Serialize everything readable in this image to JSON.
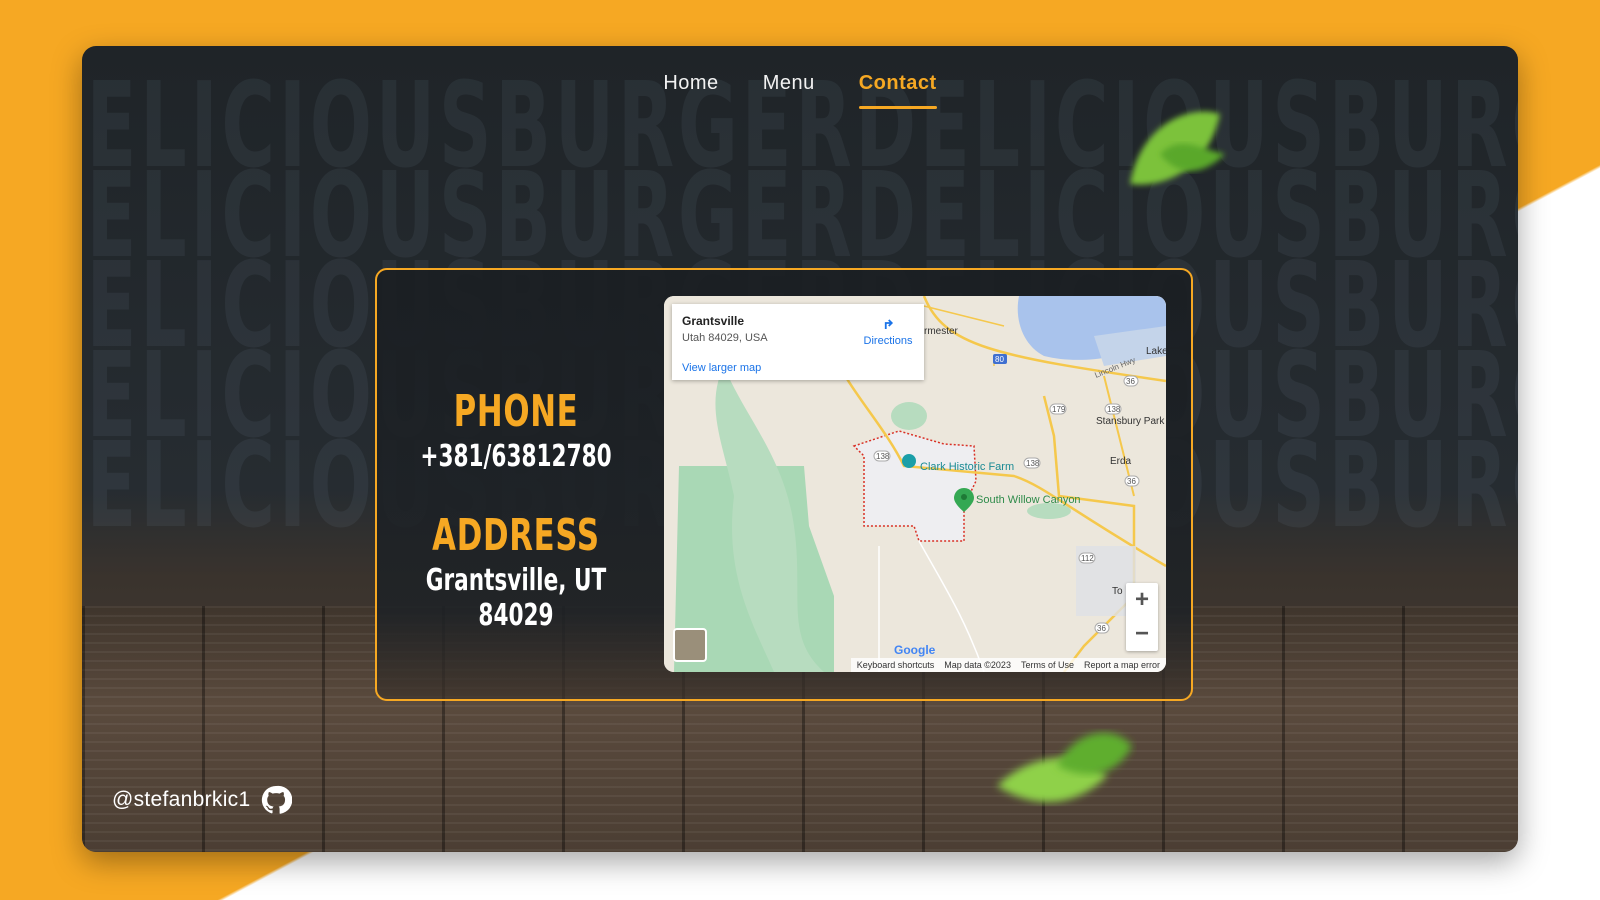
{
  "brand_color": "#f6a823",
  "background_text": [
    "DELICIOUSBURGERDELICIOUSBURGER",
    "DELICIOUSBURGERDELICIOUSBURGER",
    "DELICIOUSBURGERDELICIOUSBURGER",
    "DELICIOUSBURGERDELICIOUSBURGER",
    "DELICIOUSBURGERDELICIOUSBURGER"
  ],
  "nav": {
    "home": "Home",
    "menu": "Menu",
    "contact": "Contact",
    "active": "Contact"
  },
  "contact": {
    "phone_label": "PHONE",
    "phone_value": "+381/63812780",
    "address_label": "ADDRESS",
    "address_value": "Grantsville, UT 84029"
  },
  "map": {
    "place_title": "Grantsville",
    "place_subtitle": "Utah 84029, USA",
    "directions_label": "Directions",
    "larger_map_link": "View larger map",
    "labels": {
      "clark": "Clark Historic Farm",
      "willow": "South Willow Canyon",
      "stansbury": "Stansbury Park",
      "erda": "Erda",
      "lake": "Lake",
      "lincoln": "Lincoln Hwy",
      "rmester": "rmester",
      "to": "To",
      "google": "Google"
    },
    "road_badges": [
      "80",
      "179",
      "138",
      "138",
      "36",
      "36",
      "112",
      "36",
      "138"
    ],
    "footer": [
      "Keyboard shortcuts",
      "Map data ©2023",
      "Terms of Use",
      "Report a map error"
    ],
    "zoom_in": "+",
    "zoom_out": "−"
  },
  "footer": {
    "handle": "@stefanbrkic1"
  }
}
